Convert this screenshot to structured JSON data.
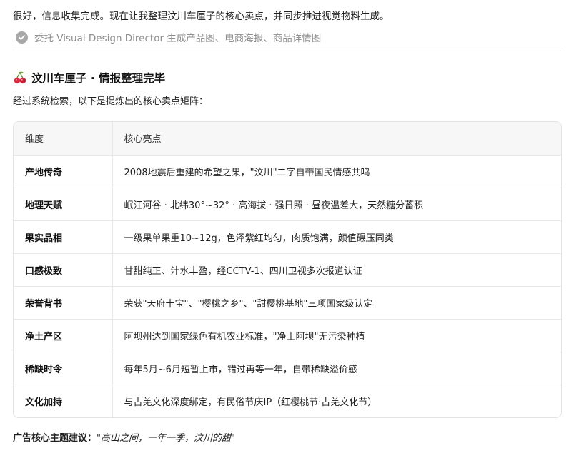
{
  "intro": "很好，信息收集完成。现在让我整理汶川车厘子的核心卖点，并同步推进视觉物料生成。",
  "task": {
    "label": "委托 Visual Design Director 生成产品图、电商海报、商品详情图",
    "icon": "check-circle-icon"
  },
  "heading": {
    "emoji": "cherry-icon",
    "text": "汶川车厘子 · 情报整理完毕"
  },
  "subtitle": "经过系统检索，以下是提炼出的核心卖点矩阵：",
  "table": {
    "headers": [
      "维度",
      "核心亮点"
    ],
    "rows": [
      [
        "产地传奇",
        "2008地震后重建的希望之果，\"汶川\"二字自带国民情感共鸣"
      ],
      [
        "地理天赋",
        "岷江河谷 · 北纬30°~32° · 高海拔 · 强日照 · 昼夜温差大，天然糖分蓄积"
      ],
      [
        "果实品相",
        "一级果单果重10~12g，色泽紫红均匀，肉质饱满，颜值碾压同类"
      ],
      [
        "口感极致",
        "甘甜纯正、汁水丰盈，经CCTV-1、四川卫视多次报道认证"
      ],
      [
        "荣誉背书",
        "荣获\"天府十宝\"、\"樱桃之乡\"、\"甜樱桃基地\"三项国家级认定"
      ],
      [
        "净土产区",
        "阿坝州达到国家绿色有机农业标准，\"净土阿坝\"无污染种植"
      ],
      [
        "稀缺时令",
        "每年5月~6月短暂上市，错过再等一年，自带稀缺溢价感"
      ],
      [
        "文化加持",
        "与古羌文化深度绑定，有民俗节庆IP（红樱桃节·古羌文化节）"
      ]
    ]
  },
  "footer": {
    "label": "广告核心主题建议：",
    "quote": "\"高山之间，一年一季，汶川的甜\""
  }
}
